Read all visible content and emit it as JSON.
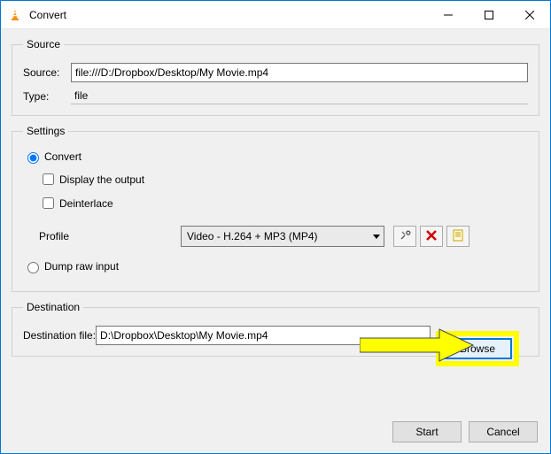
{
  "window": {
    "title": "Convert"
  },
  "source_group": {
    "legend": "Source",
    "source_label": "Source:",
    "source_value": "file:///D:/Dropbox/Desktop/My Movie.mp4",
    "type_label": "Type:",
    "type_value": "file"
  },
  "settings_group": {
    "legend": "Settings",
    "convert_label": "Convert",
    "display_output_label": "Display the output",
    "deinterlace_label": "Deinterlace",
    "profile_label": "Profile",
    "profile_value": "Video - H.264 + MP3 (MP4)",
    "dump_raw_label": "Dump raw input"
  },
  "destination_group": {
    "legend": "Destination",
    "dest_label": "Destination file:",
    "dest_value": "D:\\Dropbox\\Desktop\\My Movie.mp4",
    "browse_label": "Browse"
  },
  "footer": {
    "start_label": "Start",
    "cancel_label": "Cancel"
  }
}
